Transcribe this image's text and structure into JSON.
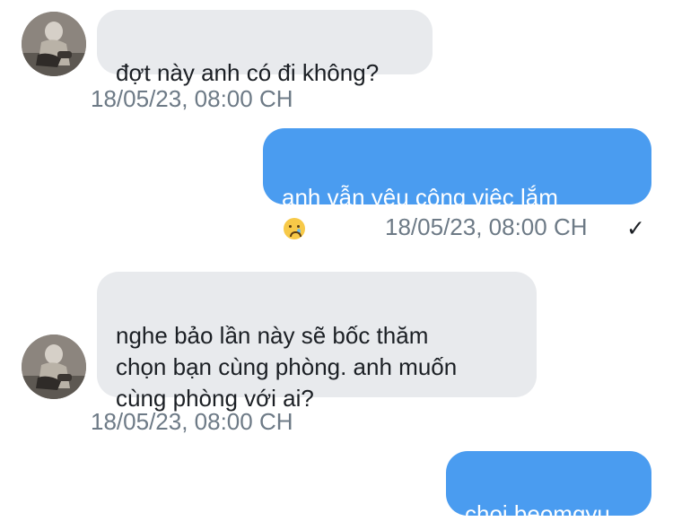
{
  "messages": [
    {
      "direction": "incoming",
      "text": "đợt này anh có đi không?",
      "timestamp": "18/05/23, 08:00 CH",
      "avatar": "user-avatar"
    },
    {
      "direction": "outgoing",
      "text": "anh vẫn yêu công việc lắm",
      "emoji": "face-holding-back-tears-icon",
      "timestamp": "18/05/23, 08:00 CH",
      "status_icon": "✓"
    },
    {
      "direction": "incoming",
      "text": "nghe bảo lần này sẽ bốc thăm\nchọn bạn cùng phòng. anh muốn\ncùng phòng với ai?",
      "timestamp": "18/05/23, 08:00 CH",
      "avatar": "user-avatar"
    },
    {
      "direction": "outgoing",
      "text": "choi beomgyu"
    }
  ],
  "colors": {
    "incoming_bubble": "#e8eaed",
    "outgoing_bubble": "#4a9cf0",
    "timestamp": "#6d7a86"
  }
}
